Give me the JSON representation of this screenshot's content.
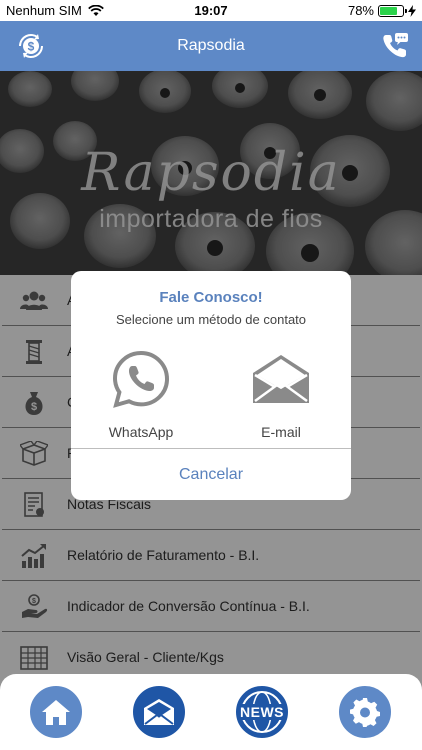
{
  "status_bar": {
    "carrier": "Nenhum SIM",
    "time": "19:07",
    "battery_percent": "78%",
    "battery_level": 0.78
  },
  "header": {
    "title": "Rapsodia",
    "left_icon": "currency-exchange-icon",
    "right_icon": "phone-chat-icon"
  },
  "banner": {
    "script_text": "Rapsodia",
    "subtitle": "importadora de fios"
  },
  "menu": {
    "items": [
      {
        "label": "A",
        "icon": "users-icon"
      },
      {
        "label": "A",
        "icon": "thread-spool-icon"
      },
      {
        "label": "C",
        "icon": "money-bag-icon"
      },
      {
        "label": "P",
        "icon": "box-icon"
      },
      {
        "label": "Notas Fiscais",
        "icon": "invoice-icon"
      },
      {
        "label": "Relatório de Faturamento - B.I.",
        "icon": "chart-growth-icon"
      },
      {
        "label": "Indicador de Conversão Contínua - B.I.",
        "icon": "hand-coin-icon"
      },
      {
        "label": "Visão Geral - Cliente/Kgs",
        "icon": "spreadsheet-icon"
      }
    ]
  },
  "dialog": {
    "title": "Fale Conosco!",
    "subtitle": "Selecione um método de contato",
    "options": [
      {
        "label": "WhatsApp",
        "icon": "whatsapp-icon"
      },
      {
        "label": "E-mail",
        "icon": "envelope-open-icon"
      }
    ],
    "cancel_label": "Cancelar"
  },
  "tab_bar": {
    "news_label": "NEWS",
    "tabs": [
      "home-icon",
      "envelope-icon",
      "news-globe-icon",
      "gear-icon"
    ]
  },
  "colors": {
    "header_bg": "#5e89c7",
    "accent_blue": "#5a82bd",
    "dark_blue": "#1f56a6",
    "battery_green": "#2bd34b"
  }
}
